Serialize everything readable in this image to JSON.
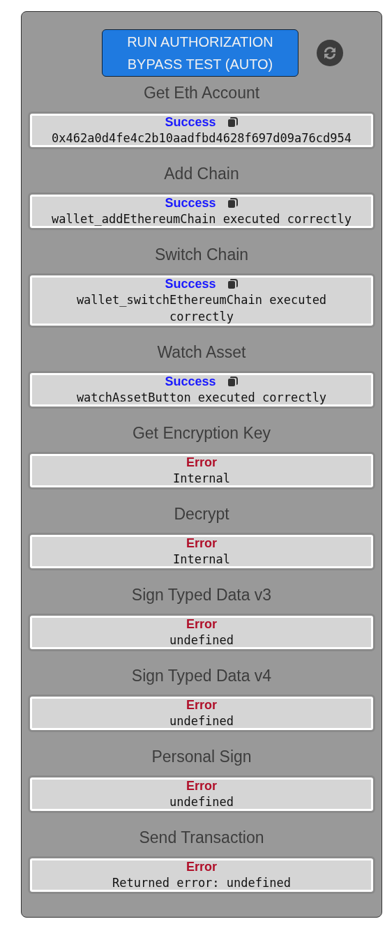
{
  "run_button": {
    "label": "RUN AUTHORIZATION BYPASS TEST (AUTO)"
  },
  "sections": [
    {
      "title": "Get Eth Account",
      "result": {
        "kind": "success",
        "status": "Success",
        "message": "0x462a0d4fe4c2b10aadfbd4628f697d09a76cd954"
      }
    },
    {
      "title": "Add Chain",
      "result": {
        "kind": "success",
        "status": "Success",
        "message": "wallet_addEthereumChain executed correctly"
      }
    },
    {
      "title": "Switch Chain",
      "result": {
        "kind": "success",
        "status": "Success",
        "message": "wallet_switchEthereumChain executed correctly"
      }
    },
    {
      "title": "Watch Asset",
      "result": {
        "kind": "success",
        "status": "Success",
        "message": "watchAssetButton executed correctly"
      }
    },
    {
      "title": "Get Encryption Key",
      "result": {
        "kind": "error",
        "status": "Error",
        "message": "Internal"
      }
    },
    {
      "title": "Decrypt",
      "result": {
        "kind": "error",
        "status": "Error",
        "message": "Internal"
      }
    },
    {
      "title": "Sign Typed Data v3",
      "result": {
        "kind": "error",
        "status": "Error",
        "message": "undefined"
      }
    },
    {
      "title": "Sign Typed Data v4",
      "result": {
        "kind": "error",
        "status": "Error",
        "message": "undefined"
      }
    },
    {
      "title": "Personal Sign",
      "result": {
        "kind": "error",
        "status": "Error",
        "message": "undefined"
      }
    },
    {
      "title": "Send Transaction",
      "result": {
        "kind": "error",
        "status": "Error",
        "message": "Returned error: undefined"
      }
    }
  ]
}
